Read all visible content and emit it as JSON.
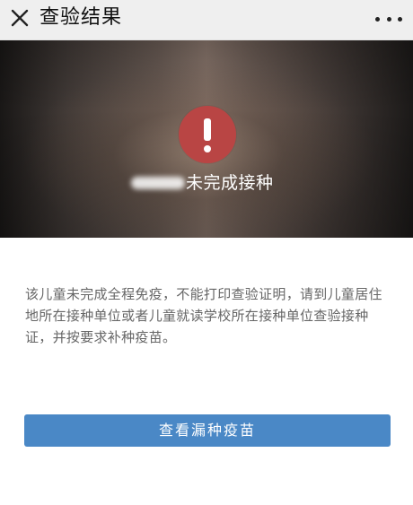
{
  "header": {
    "title": "查验结果",
    "close_icon": "close-icon",
    "more_icon": "more-icon"
  },
  "hero": {
    "alert_icon": "exclamation-icon",
    "alert_color": "#b94544",
    "status_text": "未完成接种"
  },
  "main": {
    "message": "该儿童未完成全程免疫，不能打印查验证明，请到儿童居住地所在接种单位或者儿童就读学校所在接种单位查验接种证，并按要求补种疫苗。",
    "button_label": "查看漏种疫苗",
    "button_color": "#4a88c6"
  }
}
